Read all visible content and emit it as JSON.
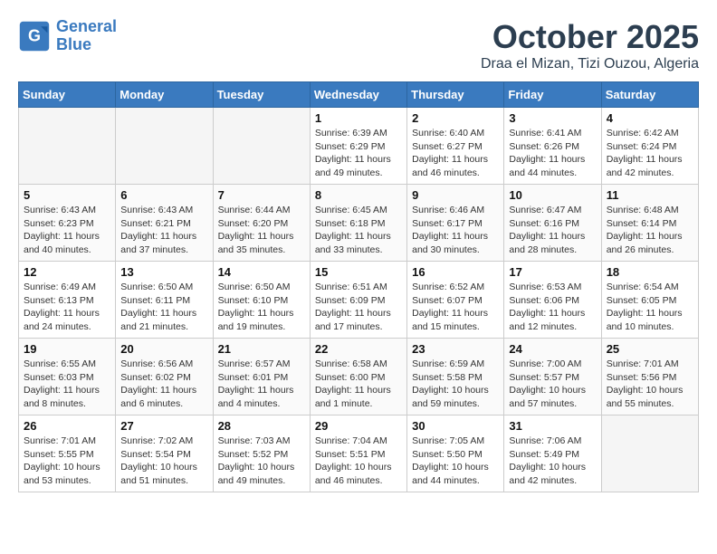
{
  "logo": {
    "line1": "General",
    "line2": "Blue"
  },
  "title": "October 2025",
  "subtitle": "Draa el Mizan, Tizi Ouzou, Algeria",
  "headers": [
    "Sunday",
    "Monday",
    "Tuesday",
    "Wednesday",
    "Thursday",
    "Friday",
    "Saturday"
  ],
  "weeks": [
    [
      {
        "day": "",
        "info": ""
      },
      {
        "day": "",
        "info": ""
      },
      {
        "day": "",
        "info": ""
      },
      {
        "day": "1",
        "info": "Sunrise: 6:39 AM\nSunset: 6:29 PM\nDaylight: 11 hours\nand 49 minutes."
      },
      {
        "day": "2",
        "info": "Sunrise: 6:40 AM\nSunset: 6:27 PM\nDaylight: 11 hours\nand 46 minutes."
      },
      {
        "day": "3",
        "info": "Sunrise: 6:41 AM\nSunset: 6:26 PM\nDaylight: 11 hours\nand 44 minutes."
      },
      {
        "day": "4",
        "info": "Sunrise: 6:42 AM\nSunset: 6:24 PM\nDaylight: 11 hours\nand 42 minutes."
      }
    ],
    [
      {
        "day": "5",
        "info": "Sunrise: 6:43 AM\nSunset: 6:23 PM\nDaylight: 11 hours\nand 40 minutes."
      },
      {
        "day": "6",
        "info": "Sunrise: 6:43 AM\nSunset: 6:21 PM\nDaylight: 11 hours\nand 37 minutes."
      },
      {
        "day": "7",
        "info": "Sunrise: 6:44 AM\nSunset: 6:20 PM\nDaylight: 11 hours\nand 35 minutes."
      },
      {
        "day": "8",
        "info": "Sunrise: 6:45 AM\nSunset: 6:18 PM\nDaylight: 11 hours\nand 33 minutes."
      },
      {
        "day": "9",
        "info": "Sunrise: 6:46 AM\nSunset: 6:17 PM\nDaylight: 11 hours\nand 30 minutes."
      },
      {
        "day": "10",
        "info": "Sunrise: 6:47 AM\nSunset: 6:16 PM\nDaylight: 11 hours\nand 28 minutes."
      },
      {
        "day": "11",
        "info": "Sunrise: 6:48 AM\nSunset: 6:14 PM\nDaylight: 11 hours\nand 26 minutes."
      }
    ],
    [
      {
        "day": "12",
        "info": "Sunrise: 6:49 AM\nSunset: 6:13 PM\nDaylight: 11 hours\nand 24 minutes."
      },
      {
        "day": "13",
        "info": "Sunrise: 6:50 AM\nSunset: 6:11 PM\nDaylight: 11 hours\nand 21 minutes."
      },
      {
        "day": "14",
        "info": "Sunrise: 6:50 AM\nSunset: 6:10 PM\nDaylight: 11 hours\nand 19 minutes."
      },
      {
        "day": "15",
        "info": "Sunrise: 6:51 AM\nSunset: 6:09 PM\nDaylight: 11 hours\nand 17 minutes."
      },
      {
        "day": "16",
        "info": "Sunrise: 6:52 AM\nSunset: 6:07 PM\nDaylight: 11 hours\nand 15 minutes."
      },
      {
        "day": "17",
        "info": "Sunrise: 6:53 AM\nSunset: 6:06 PM\nDaylight: 11 hours\nand 12 minutes."
      },
      {
        "day": "18",
        "info": "Sunrise: 6:54 AM\nSunset: 6:05 PM\nDaylight: 11 hours\nand 10 minutes."
      }
    ],
    [
      {
        "day": "19",
        "info": "Sunrise: 6:55 AM\nSunset: 6:03 PM\nDaylight: 11 hours\nand 8 minutes."
      },
      {
        "day": "20",
        "info": "Sunrise: 6:56 AM\nSunset: 6:02 PM\nDaylight: 11 hours\nand 6 minutes."
      },
      {
        "day": "21",
        "info": "Sunrise: 6:57 AM\nSunset: 6:01 PM\nDaylight: 11 hours\nand 4 minutes."
      },
      {
        "day": "22",
        "info": "Sunrise: 6:58 AM\nSunset: 6:00 PM\nDaylight: 11 hours\nand 1 minute."
      },
      {
        "day": "23",
        "info": "Sunrise: 6:59 AM\nSunset: 5:58 PM\nDaylight: 10 hours\nand 59 minutes."
      },
      {
        "day": "24",
        "info": "Sunrise: 7:00 AM\nSunset: 5:57 PM\nDaylight: 10 hours\nand 57 minutes."
      },
      {
        "day": "25",
        "info": "Sunrise: 7:01 AM\nSunset: 5:56 PM\nDaylight: 10 hours\nand 55 minutes."
      }
    ],
    [
      {
        "day": "26",
        "info": "Sunrise: 7:01 AM\nSunset: 5:55 PM\nDaylight: 10 hours\nand 53 minutes."
      },
      {
        "day": "27",
        "info": "Sunrise: 7:02 AM\nSunset: 5:54 PM\nDaylight: 10 hours\nand 51 minutes."
      },
      {
        "day": "28",
        "info": "Sunrise: 7:03 AM\nSunset: 5:52 PM\nDaylight: 10 hours\nand 49 minutes."
      },
      {
        "day": "29",
        "info": "Sunrise: 7:04 AM\nSunset: 5:51 PM\nDaylight: 10 hours\nand 46 minutes."
      },
      {
        "day": "30",
        "info": "Sunrise: 7:05 AM\nSunset: 5:50 PM\nDaylight: 10 hours\nand 44 minutes."
      },
      {
        "day": "31",
        "info": "Sunrise: 7:06 AM\nSunset: 5:49 PM\nDaylight: 10 hours\nand 42 minutes."
      },
      {
        "day": "",
        "info": ""
      }
    ]
  ]
}
